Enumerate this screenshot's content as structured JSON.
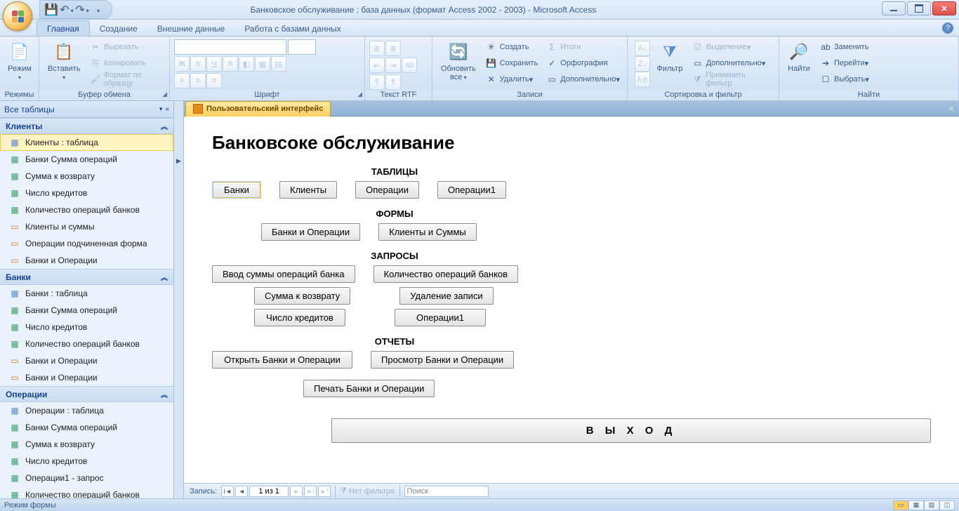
{
  "title": "Банковское обслуживание : база данных (формат Access 2002 - 2003) - Microsoft Access",
  "tabs": {
    "home": "Главная",
    "create": "Создание",
    "external": "Внешние данные",
    "dbtools": "Работа с базами данных"
  },
  "ribbon": {
    "views": {
      "label": "Режимы",
      "btn": "Режим"
    },
    "clipboard": {
      "label": "Буфер обмена",
      "paste": "Вставить",
      "cut": "Вырезать",
      "copy": "Копировать",
      "fmt": "Формат по образцу"
    },
    "font": {
      "label": "Шрифт"
    },
    "richtext": {
      "label": "Текст RTF"
    },
    "records": {
      "label": "Записи",
      "refresh": "Обновить все",
      "new": "Создать",
      "save": "Сохранить",
      "delete": "Удалить",
      "totals": "Итоги",
      "spell": "Орфография",
      "more": "Дополнительно"
    },
    "sortfilter": {
      "label": "Сортировка и фильтр",
      "filter": "Фильтр",
      "selection": "Выделение",
      "advanced": "Дополнительно",
      "toggle": "Применить фильтр"
    },
    "find": {
      "label": "Найти",
      "find": "Найти",
      "replace": "Заменить",
      "goto": "Перейти",
      "select": "Выбрать"
    }
  },
  "nav": {
    "head": "Все таблицы",
    "groups": [
      {
        "name": "Клиенты",
        "items": [
          {
            "label": "Клиенты : таблица",
            "type": "table",
            "selected": true
          },
          {
            "label": "Банки Сумма операций",
            "type": "query"
          },
          {
            "label": "Сумма к возврату",
            "type": "query"
          },
          {
            "label": "Число кредитов",
            "type": "query"
          },
          {
            "label": "Количество операций банков",
            "type": "query"
          },
          {
            "label": "Клиенты и суммы",
            "type": "form"
          },
          {
            "label": "Операции подчиненная форма",
            "type": "form"
          },
          {
            "label": "Банки и Операции",
            "type": "form"
          }
        ]
      },
      {
        "name": "Банки",
        "items": [
          {
            "label": "Банки : таблица",
            "type": "table"
          },
          {
            "label": "Банки Сумма операций",
            "type": "query"
          },
          {
            "label": "Число кредитов",
            "type": "query"
          },
          {
            "label": "Количество операций банков",
            "type": "query"
          },
          {
            "label": "Банки и Операции",
            "type": "form"
          },
          {
            "label": "Банки и Операции",
            "type": "form"
          }
        ]
      },
      {
        "name": "Операции",
        "items": [
          {
            "label": "Операции : таблица",
            "type": "table"
          },
          {
            "label": "Банки Сумма операций",
            "type": "query"
          },
          {
            "label": "Сумма к возврату",
            "type": "query"
          },
          {
            "label": "Число кредитов",
            "type": "query"
          },
          {
            "label": "Операции1 - запрос",
            "type": "query"
          },
          {
            "label": "Количество операций банков",
            "type": "query"
          }
        ]
      }
    ]
  },
  "doc": {
    "tab": "Пользовательский интерфейс",
    "title": "Банковсоке обслуживание",
    "sections": {
      "tables": {
        "label": "ТАБЛИЦЫ",
        "btns": [
          "Банки",
          "Клиенты",
          "Операции",
          "Операции1"
        ]
      },
      "forms": {
        "label": "ФОРМЫ",
        "btns": [
          "Банки и Операции",
          "Клиенты и Суммы"
        ]
      },
      "queries": {
        "label": "ЗАПРОСЫ",
        "rows": [
          [
            "Ввод суммы операций банка",
            "Количество операций банков"
          ],
          [
            "Сумма к возврату",
            "Удаление записи"
          ],
          [
            "Число кредитов",
            "Операции1"
          ]
        ]
      },
      "reports": {
        "label": "ОТЧЕТЫ",
        "rows": [
          [
            "Открыть Банки и Операции",
            "Просмотр Банки и Операции"
          ],
          [
            "Печать Банки и Операции"
          ]
        ]
      }
    },
    "exit": "В Ы Х О Д"
  },
  "recnav": {
    "label": "Запись:",
    "pos": "1 из 1",
    "nofilter": "Нет фильтра",
    "search": "Поиск"
  },
  "status": "Режим формы"
}
